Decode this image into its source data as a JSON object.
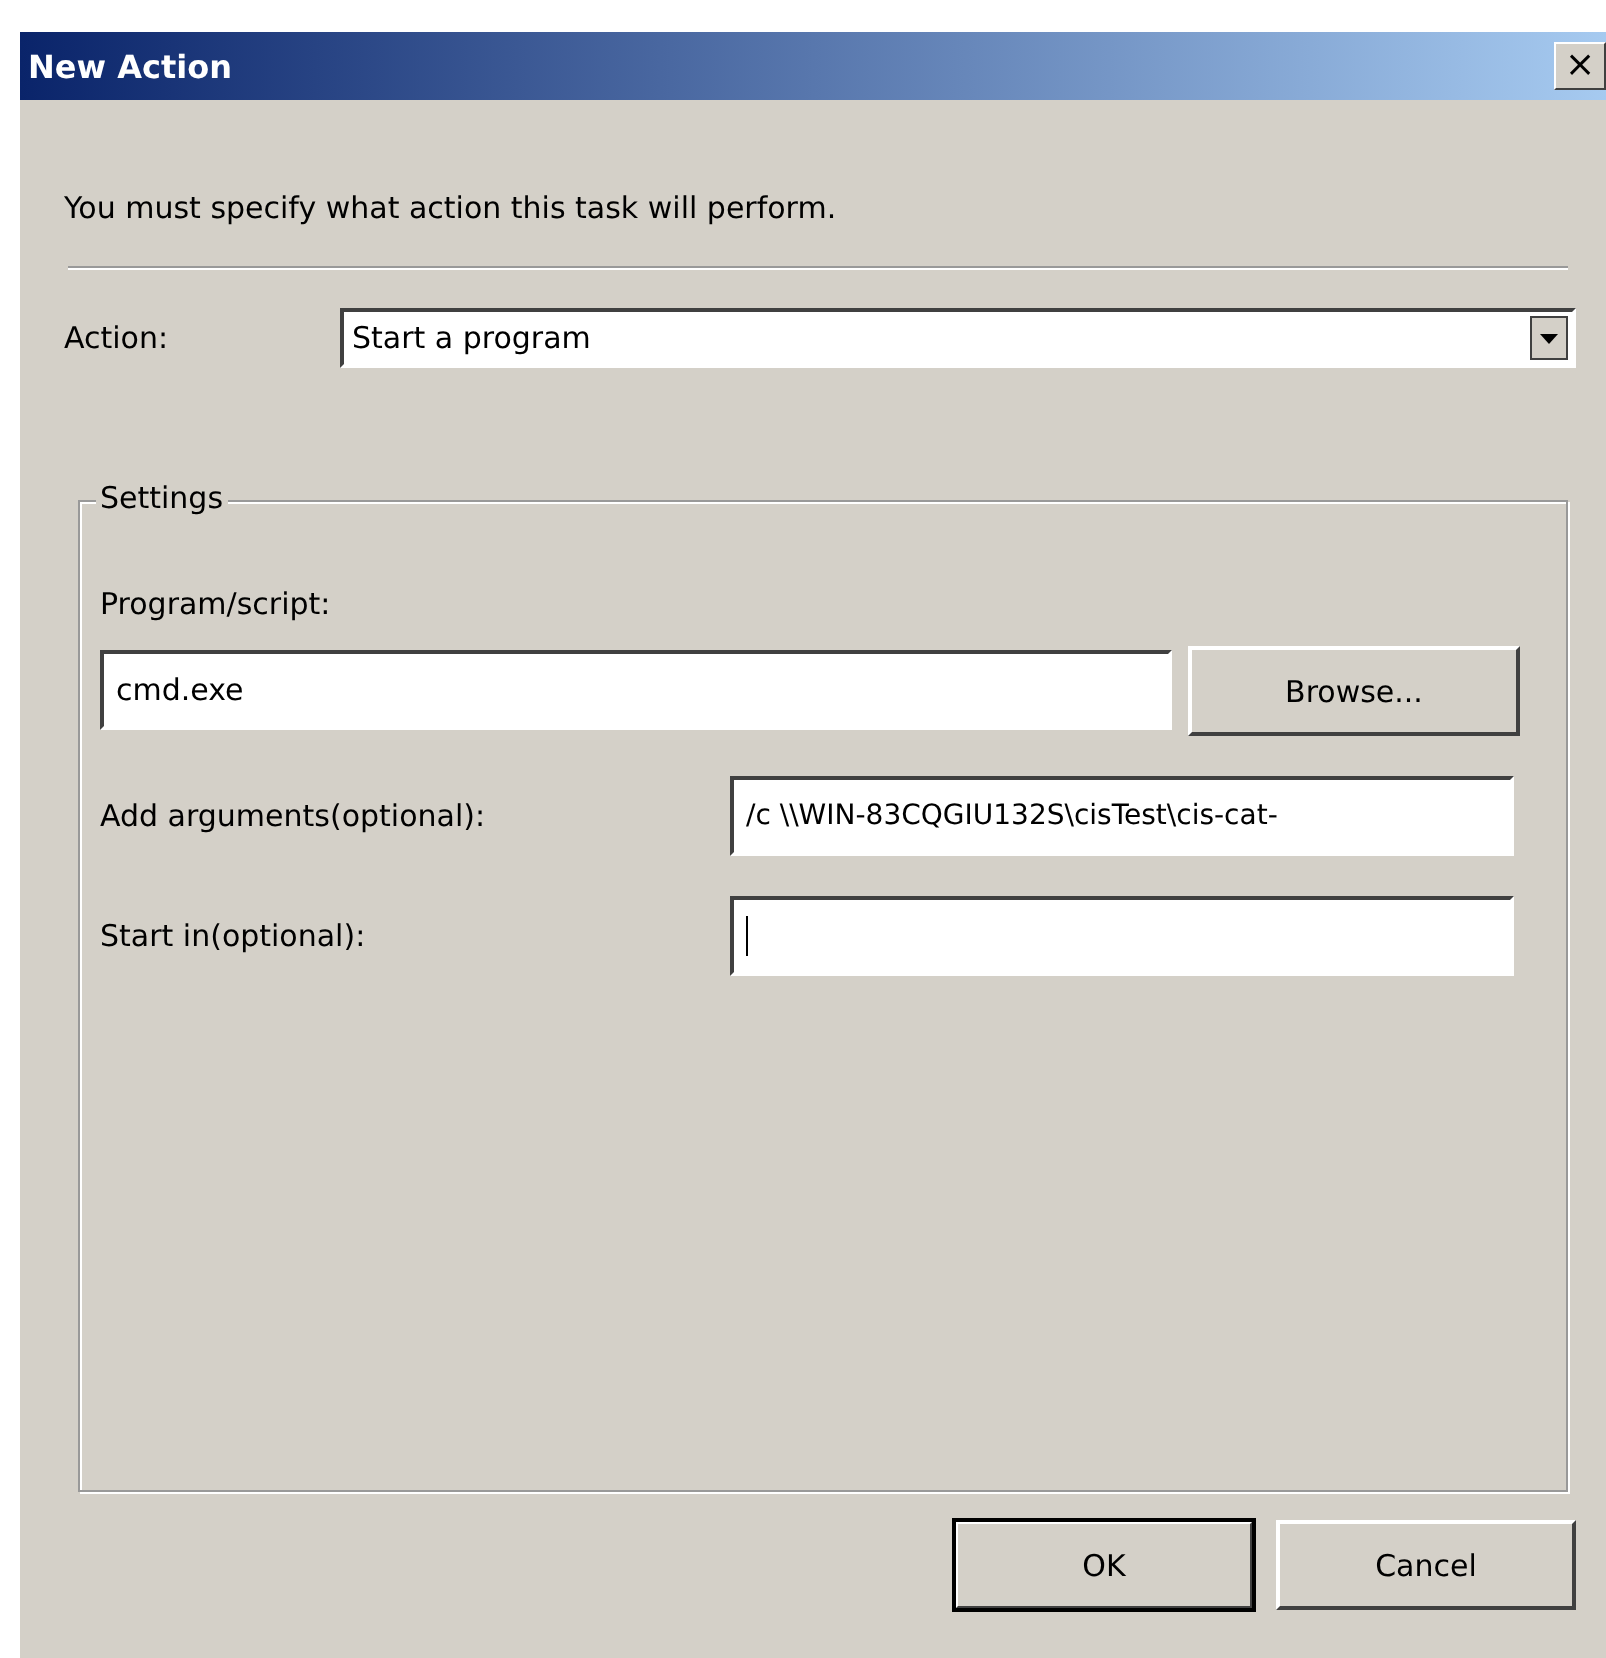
{
  "window": {
    "title": "New Action",
    "close_label": "×"
  },
  "instruction": "You must specify what action this task will perform.",
  "action": {
    "label": "Action:",
    "value": "Start a program"
  },
  "settings": {
    "title": "Settings",
    "program": {
      "label": "Program/script:",
      "value": "cmd.exe",
      "browse": "Browse..."
    },
    "fields": [
      {
        "label": "Add arguments(optional):",
        "value": "/c \\\\WIN-83CQGIU132S\\cisTest\\cis-cat-",
        "focused": false
      },
      {
        "label": "Start in(optional):",
        "focused": true
      }
    ]
  },
  "buttons": [
    {
      "label": "OK",
      "default": true
    },
    {
      "label": "Cancel",
      "default": false
    }
  ]
}
